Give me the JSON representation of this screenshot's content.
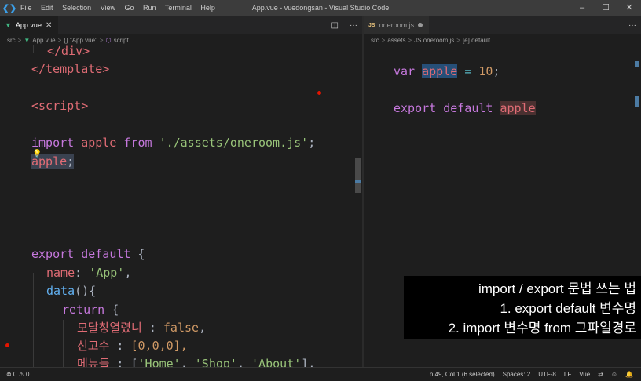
{
  "titlebar": {
    "menu": [
      "File",
      "Edit",
      "Selection",
      "View",
      "Go",
      "Run",
      "Terminal",
      "Help"
    ],
    "title": "App.vue - vuedongsan - Visual Studio Code",
    "controls": [
      "–",
      "☐",
      "✕"
    ]
  },
  "left_pane": {
    "tab_label": "App.vue",
    "tab_close": "✕",
    "split_icon": "◫",
    "more_icon": "···",
    "breadcrumb": [
      "src",
      ">",
      "App.vue",
      ">",
      "{} \"App.vue\"",
      ">",
      "script"
    ],
    "code": {
      "l1": "</div>",
      "l2": "</template>",
      "l3": "<script>",
      "l4_import": "import",
      "l4_apple": "apple",
      "l4_from": "from",
      "l4_path": "'./assets/oneroom.js'",
      "l4_semi": ";",
      "l5_apple": "apple",
      "l5_semi": ";",
      "l6_export": "export",
      "l6_default": "default",
      "l6_brace": "{",
      "l7_key": "name",
      "l7_colon": ":",
      "l7_val": "'App'",
      "l7_comma": ",",
      "l8_fn": "data",
      "l8_rest": "(){",
      "l9_return": "return",
      "l9_brace": "{",
      "l10_key": "모달창열렸니",
      "l10_colon": " :",
      "l10_val": "false",
      "l10_comma": ",",
      "l11_key": "신고수",
      "l11_colon": " :",
      "l11_rest": "[0,0,0],",
      "l12_key": "메뉴들",
      "l12_colon": " :",
      "l12_b": " [",
      "l12_s1": "'Home'",
      "l12_c1": ", ",
      "l12_s2": "'Shop'",
      "l12_c2": ", ",
      "l12_s3": "'About'",
      "l12_end": "],"
    }
  },
  "right_pane": {
    "tab_label": "oneroom.js",
    "js_badge": "JS",
    "more_icon": "···",
    "breadcrumb": [
      "src",
      ">",
      "assets",
      ">",
      "JS oneroom.js",
      ">",
      "[e] default"
    ],
    "code": {
      "l1_var": "var",
      "l1_apple": "apple",
      "l1_eq": "=",
      "l1_num": "10",
      "l1_semi": ";",
      "l2_export": "export",
      "l2_default": "default",
      "l2_apple": "apple"
    }
  },
  "statusbar": {
    "left": "⊗ 0 ⚠ 0",
    "position": "Ln 49, Col 1 (6 selected)",
    "spaces": "Spaces: 2",
    "encoding": "UTF-8",
    "eol": "LF",
    "language": "Vue"
  },
  "caption": {
    "line1": "import / export 문법 쓰는 법",
    "line2": "1. export default 변수명",
    "line3": "2. import 변수명 from 그파일경로"
  }
}
